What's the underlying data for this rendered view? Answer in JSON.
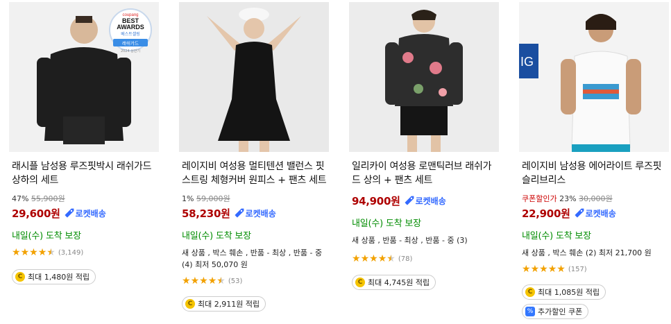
{
  "products": [
    {
      "name": "래시플 남성용 루즈핏박시 래쉬가드 상하의 세트",
      "discount": "47%",
      "original_price": "55,900원",
      "price": "29,600원",
      "rocket": "로켓배송",
      "arrival": "내일(수) 도착 보장",
      "used_text": "",
      "rating": 4.5,
      "review_count": "(3,149)",
      "reward": "최대 1,480원 적립",
      "badge": {
        "brand": "coupang",
        "line1": "BEST",
        "line2": "AWARDS",
        "line3": "베스트셀링",
        "ribbon": "래쉬가드",
        "year": "2024 상반기"
      }
    },
    {
      "name": "레이지비 여성용 멀티텐션 밸런스 핏 스트링 체형커버 원피스 + 팬츠 세트",
      "discount": "1%",
      "original_price": "59,000원",
      "price": "58,230원",
      "rocket": "로켓배송",
      "arrival": "내일(수) 도착 보장",
      "used_text": "새 상품 , 박스 훼손 , 반품 - 최상 , 반품 - 중 (4) 최저 50,070 원",
      "rating": 4.5,
      "review_count": "(53)",
      "reward": "최대 2,911원 적립"
    },
    {
      "name": "일리카이 여성용 로맨틱러브 래쉬가드 상의 + 팬츠 세트",
      "discount": "",
      "original_price": "",
      "price": "94,900원",
      "rocket": "로켓배송",
      "arrival": "내일(수) 도착 보장",
      "used_text": "새 상품 , 반품 - 최상 , 반품 - 중 (3)",
      "rating": 4.5,
      "review_count": "(78)",
      "reward": "최대 4,745원 적립"
    },
    {
      "name": "레이지비 남성용 에어라이트 루즈핏 슬리브리스",
      "coupon_label": "쿠폰할인가",
      "discount": "23%",
      "original_price": "30,000원",
      "price": "22,900원",
      "rocket": "로켓배송",
      "arrival": "내일(수) 도착 보장",
      "used_text": "새 상품 , 박스 훼손 (2) 최저 21,700 원",
      "rating": 5,
      "review_count": "(157)",
      "reward": "최대 1,085원 적립",
      "extra": "추가할인 쿠폰"
    }
  ],
  "colors": {
    "price": "#ae0000",
    "rocket": "#346aff",
    "arrival": "#008c00",
    "star": "#f2a100"
  }
}
